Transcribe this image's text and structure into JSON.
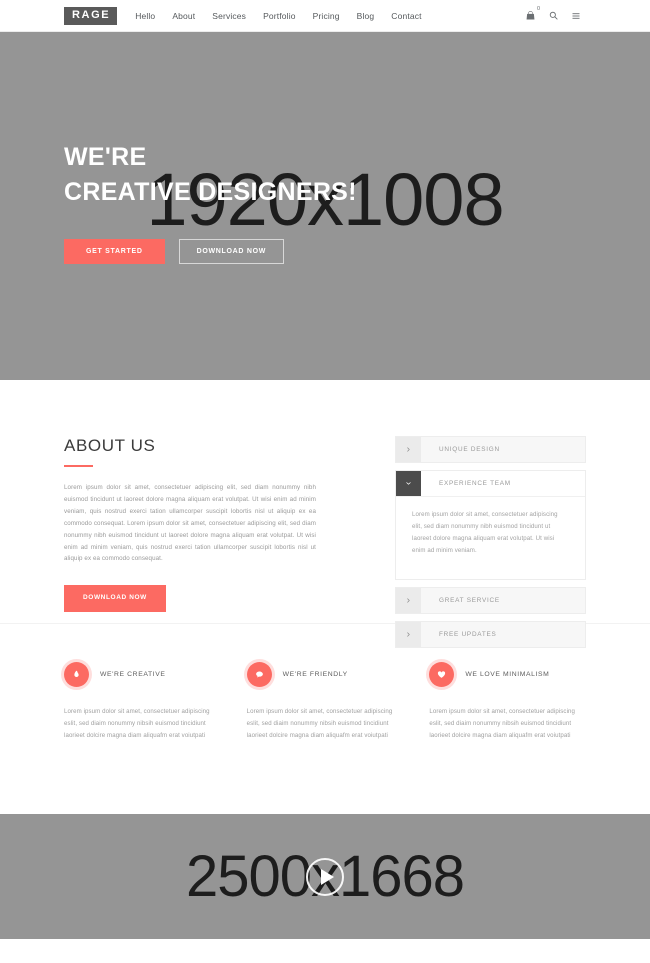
{
  "header": {
    "logo": "RAGE",
    "nav": [
      {
        "label": "Hello"
      },
      {
        "label": "About"
      },
      {
        "label": "Services"
      },
      {
        "label": "Portfolio"
      },
      {
        "label": "Pricing"
      },
      {
        "label": "Blog"
      },
      {
        "label": "Contact"
      }
    ],
    "cart_icon": "shopping-cart-icon",
    "cart_count": "0",
    "search_icon": "search-icon",
    "menu_icon": "hamburger-menu-icon"
  },
  "hero": {
    "placeholder": "1920x1008",
    "title_line1": "WE'RE",
    "title_line2": "CREATIVE DESIGNERS!",
    "primary_button": "GET STARTED",
    "secondary_button": "DOWNLOAD NOW"
  },
  "about": {
    "title": "ABOUT US",
    "paragraph": "Lorem ipsum dolor sit amet, consectetuer adipiscing elit, sed diam nonummy nibh euismod tincidunt ut laoreet dolore magna aliquam erat volutpat. Ut wisi enim ad minim veniam, quis nostrud exerci tation ullamcorper suscipit lobortis nisl ut aliquip ex ea commodo consequat. Lorem ipsum dolor sit amet, consectetuer adipiscing elit, sed diam nonummy nibh euismod tincidunt ut laoreet dolore magna aliquam erat volutpat. Ut wisi enim ad minim veniam, quis nostrud exerci tation ullamcorper suscipit lobortis nisl ut aliquip ex ea commodo consequat.",
    "download_button": "DOWNLOAD NOW",
    "accordion": [
      {
        "label": "UNIQUE DESIGN",
        "open": false,
        "body": ""
      },
      {
        "label": "EXPERIENCE TEAM",
        "open": true,
        "body": "Lorem ipsum dolor sit amet, consectetuer adipiscing elit, sed diam nonummy nibh euismod tincidunt ut laoreet dolore magna aliquam erat volutpat. Ut wisi enim ad minim veniam."
      },
      {
        "label": "GREAT SERVICE",
        "open": false,
        "body": ""
      },
      {
        "label": "FREE UPDATES",
        "open": false,
        "body": ""
      }
    ]
  },
  "features": [
    {
      "icon": "flame-icon",
      "title": "WE'RE CREATIVE",
      "text": "Lorem ipsum dolor sit amet, consectetuer adipiscing eslit, sed diaim nonummy nibsih euismod tincidiunt laorieet dolcire magna diam aliquafm erat voiutpati"
    },
    {
      "icon": "speech-bubble-icon",
      "title": "WE'RE FRIENDLY",
      "text": "Lorem ipsum dolor sit amet, consectetuer adipiscing eslit, sed diaim nonummy nibsih euismod tincidiunt laorieet dolcire magna diam aliquafm erat voiutpati"
    },
    {
      "icon": "heart-icon",
      "title": "WE LOVE MINIMALISM",
      "text": "Lorem ipsum dolor sit amet, consectetuer adipiscing eslit, sed diaim nonummy nibsih euismod tincidiunt laorieet dolcire magna diam aliquafm erat voiutpati"
    }
  ],
  "video": {
    "placeholder": "2500x1668",
    "play_icon": "play-button-icon"
  },
  "colors": {
    "accent": "#fc6a62",
    "placeholder_bg": "#959595",
    "logo_bg": "#5a5a5a",
    "accordion_open": "#4c4c4c"
  }
}
